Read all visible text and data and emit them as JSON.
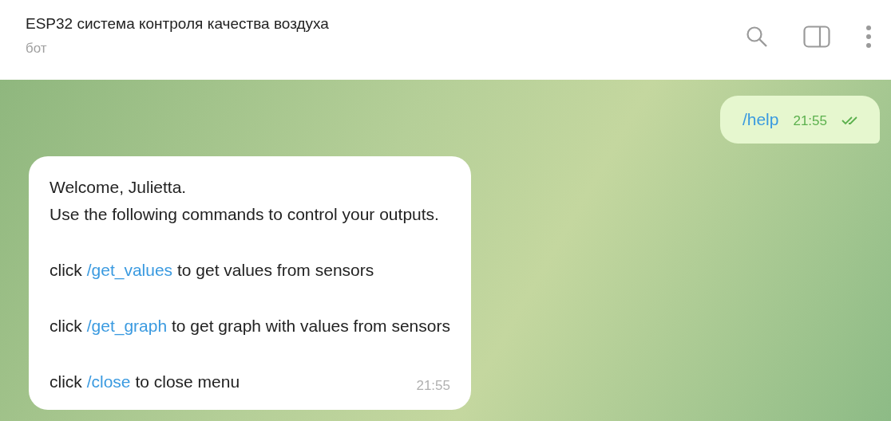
{
  "chat": {
    "title": "ESP32 система контроля качества воздуха",
    "subtitle": "бот"
  },
  "messages": [
    {
      "kind": "outgoing",
      "text": "/help",
      "time": "21:55",
      "read": true
    },
    {
      "kind": "incoming",
      "time": "21:55",
      "lines": [
        {
          "kind": "text",
          "text": "Welcome, Julietta."
        },
        {
          "kind": "text",
          "text": "Use the following commands to control your outputs."
        },
        {
          "kind": "command",
          "before": "click",
          "command": "/get_values",
          "after": "to get values from sensors"
        },
        {
          "kind": "command",
          "before": "click",
          "command": "/get_graph",
          "after": "to get graph with values from sensors"
        },
        {
          "kind": "command",
          "before": "click",
          "command": "/close",
          "after": "to close menu"
        }
      ]
    }
  ]
}
